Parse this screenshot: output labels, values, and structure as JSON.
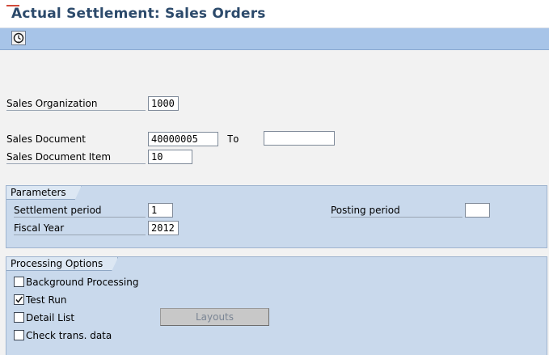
{
  "window": {
    "title": "Actual Settlement: Sales Orders"
  },
  "toolbar": {
    "execute_icon": "execute-clock-icon"
  },
  "selection": {
    "sales_organization": {
      "label": "Sales Organization",
      "value": "1000"
    },
    "sales_document": {
      "label": "Sales Document",
      "value": "40000005",
      "to_label": "To",
      "to_value": ""
    },
    "sales_document_item": {
      "label": "Sales Document Item",
      "value": "10"
    }
  },
  "parameters": {
    "title": "Parameters",
    "settlement_period": {
      "label": "Settlement period",
      "value": "1"
    },
    "fiscal_year": {
      "label": "Fiscal Year",
      "value": "2012"
    },
    "posting_period": {
      "label": "Posting period",
      "value": ""
    }
  },
  "processing_options": {
    "title": "Processing Options",
    "background_processing": {
      "label": "Background Processing",
      "checked": false
    },
    "test_run": {
      "label": "Test Run",
      "checked": true
    },
    "detail_list": {
      "label": "Detail List",
      "checked": false
    },
    "check_trans_data": {
      "label": "Check trans. data",
      "checked": false
    },
    "layouts_button": "Layouts"
  }
}
